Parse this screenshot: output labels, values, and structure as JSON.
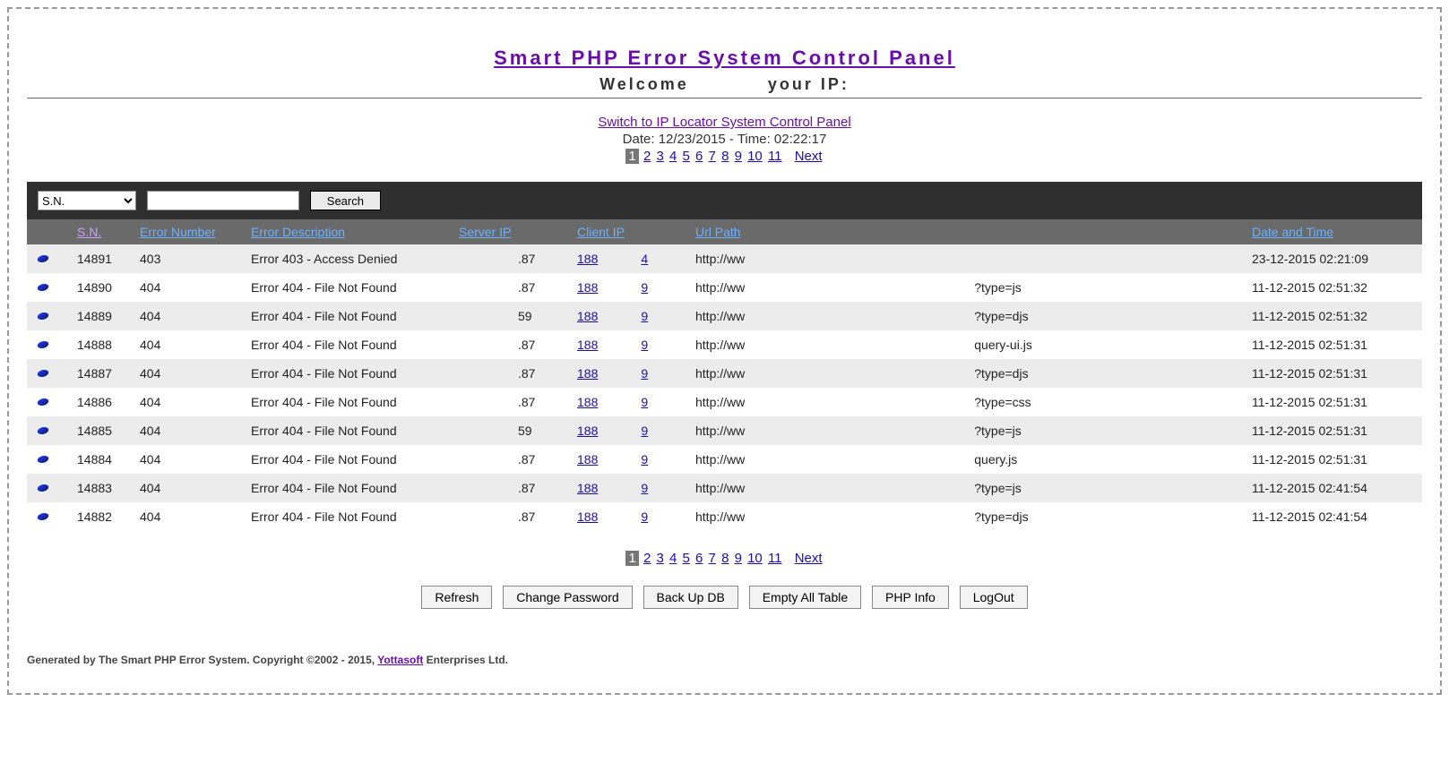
{
  "header": {
    "title": "Smart PHP Error System Control Panel",
    "welcome": "Welcome",
    "your_ip_label": "your IP:"
  },
  "links": {
    "switch_panel": "Switch to IP Locator System Control Panel"
  },
  "datetime_line": "Date: 12/23/2015 - Time: 02:22:17",
  "pager": {
    "current": "1",
    "pages": [
      "2",
      "3",
      "4",
      "5",
      "6",
      "7",
      "8",
      "9",
      "10",
      "11"
    ],
    "next": "Next"
  },
  "search": {
    "selected": "S.N.",
    "options": [
      "S.N.",
      "Error Number",
      "Error Description",
      "Server IP",
      "Client IP",
      "Url Path",
      "Date and Time"
    ],
    "button": "Search"
  },
  "columns": {
    "sn": "S.N.",
    "en": "Error Number",
    "ed": "Error Description",
    "sip": "Server IP",
    "cip": "Client IP",
    "url": "Url Path",
    "dt": "Date and Time"
  },
  "rows": [
    {
      "sn": "14891",
      "en": "403",
      "ed": "Error 403 - Access Denied",
      "sip_tail": ".87",
      "cip_a": "188",
      "cip_b": "4",
      "url_pre": "http://ww",
      "url_suf": "",
      "dt": "23-12-2015 02:21:09"
    },
    {
      "sn": "14890",
      "en": "404",
      "ed": "Error 404 - File Not Found",
      "sip_tail": ".87",
      "cip_a": "188",
      "cip_b": "9",
      "url_pre": "http://ww",
      "url_suf": "?type=js",
      "dt": "11-12-2015 02:51:32"
    },
    {
      "sn": "14889",
      "en": "404",
      "ed": "Error 404 - File Not Found",
      "sip_tail": "59",
      "cip_a": "188",
      "cip_b": "9",
      "url_pre": "http://ww",
      "url_suf": "?type=djs",
      "dt": "11-12-2015 02:51:32"
    },
    {
      "sn": "14888",
      "en": "404",
      "ed": "Error 404 - File Not Found",
      "sip_tail": ".87",
      "cip_a": "188",
      "cip_b": "9",
      "url_pre": "http://ww",
      "url_suf": "query-ui.js",
      "dt": "11-12-2015 02:51:31"
    },
    {
      "sn": "14887",
      "en": "404",
      "ed": "Error 404 - File Not Found",
      "sip_tail": ".87",
      "cip_a": "188",
      "cip_b": "9",
      "url_pre": "http://ww",
      "url_suf": "?type=djs",
      "dt": "11-12-2015 02:51:31"
    },
    {
      "sn": "14886",
      "en": "404",
      "ed": "Error 404 - File Not Found",
      "sip_tail": ".87",
      "cip_a": "188",
      "cip_b": "9",
      "url_pre": "http://ww",
      "url_suf": "?type=css",
      "dt": "11-12-2015 02:51:31"
    },
    {
      "sn": "14885",
      "en": "404",
      "ed": "Error 404 - File Not Found",
      "sip_tail": "59",
      "cip_a": "188",
      "cip_b": "9",
      "url_pre": "http://ww",
      "url_suf": "?type=js",
      "dt": "11-12-2015 02:51:31"
    },
    {
      "sn": "14884",
      "en": "404",
      "ed": "Error 404 - File Not Found",
      "sip_tail": ".87",
      "cip_a": "188",
      "cip_b": "9",
      "url_pre": "http://ww",
      "url_suf": "query.js",
      "dt": "11-12-2015 02:51:31"
    },
    {
      "sn": "14883",
      "en": "404",
      "ed": "Error 404 - File Not Found",
      "sip_tail": ".87",
      "cip_a": "188",
      "cip_b": "9",
      "url_pre": "http://ww",
      "url_suf": "?type=js",
      "dt": "11-12-2015 02:41:54"
    },
    {
      "sn": "14882",
      "en": "404",
      "ed": "Error 404 - File Not Found",
      "sip_tail": ".87",
      "cip_a": "188",
      "cip_b": "9",
      "url_pre": "http://ww",
      "url_suf": "?type=djs",
      "dt": "11-12-2015 02:41:54"
    }
  ],
  "buttons": {
    "refresh": "Refresh",
    "change_pw": "Change Password",
    "backup": "Back Up DB",
    "empty": "Empty All Table",
    "phpinfo": "PHP Info",
    "logout": "LogOut"
  },
  "footer": {
    "pre": "Generated by The Smart PHP Error System. Copyright ©2002 - 2015, ",
    "link": "Yottasoft",
    "post": " Enterprises Ltd."
  }
}
